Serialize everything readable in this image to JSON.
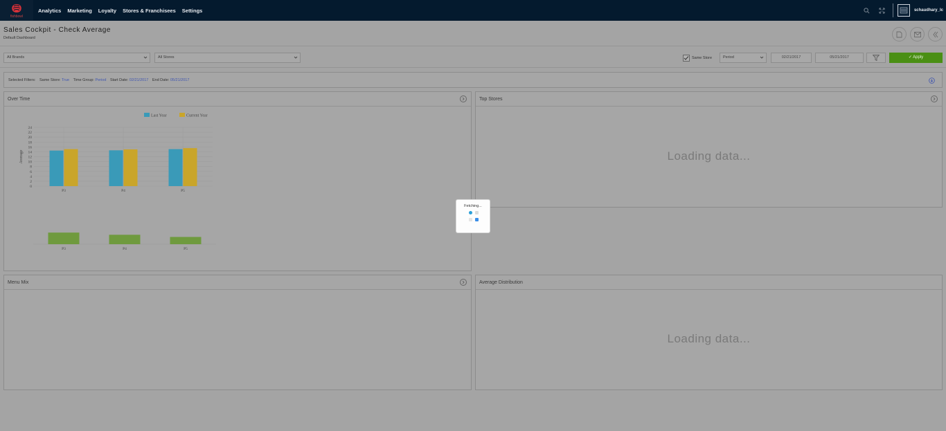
{
  "nav": {
    "logo_text": "fishbowl",
    "items": [
      "Analytics",
      "Marketing",
      "Loyalty",
      "Stores & Franchisees",
      "Settings"
    ],
    "user": "schaudhary_lc"
  },
  "page": {
    "title": "Sales Cockpit - Check Average",
    "subtitle": "Default Dashboard"
  },
  "filters": {
    "brand": "All Brands",
    "stores": "All Stores",
    "same_store_label": "Same Store",
    "same_store_checked": true,
    "time_group": "Period",
    "start_date": "02/21/2017",
    "end_date": "05/21/2017",
    "apply_label": "✓ Apply"
  },
  "selected_filters": {
    "label": "Selected Filters:",
    "same_store_key": "Same Store:",
    "same_store_val": "True",
    "time_group_key": "Time Group:",
    "time_group_val": "Period",
    "start_key": "Start Date:",
    "start_val": "02/21/2017",
    "end_key": "End Date:",
    "end_val": "05/21/2017"
  },
  "panels": {
    "over_time": "Over Time",
    "top_stores": "Top Stores",
    "menu_mix": "Menu Mix",
    "avg_dist": "Average Distribution",
    "loading": "Loading data..."
  },
  "fetching": "Fetching...",
  "colors": {
    "last_year": "#3a9ab8",
    "current_year": "#c9a52a",
    "diff_bar": "#6f9a3e",
    "nav_bg": "#041a2e",
    "apply": "#4a8f14"
  },
  "chart_data": [
    {
      "type": "bar",
      "categories": [
        "P3",
        "P4",
        "P5"
      ],
      "series": [
        {
          "name": "Last Year",
          "values": [
            14.5,
            14.6,
            15.1
          ]
        },
        {
          "name": "Current Year",
          "values": [
            15.1,
            15.0,
            15.5
          ]
        }
      ],
      "ylabel": "Average",
      "ylim": [
        0,
        24
      ],
      "yticks": [
        0,
        2,
        4,
        6,
        8,
        10,
        12,
        14,
        16,
        18,
        20,
        22,
        24
      ],
      "legend": "top"
    },
    {
      "type": "bar",
      "categories": [
        "P3",
        "P4",
        "P5"
      ],
      "values": [
        1.6,
        1.3,
        1.0
      ]
    }
  ]
}
